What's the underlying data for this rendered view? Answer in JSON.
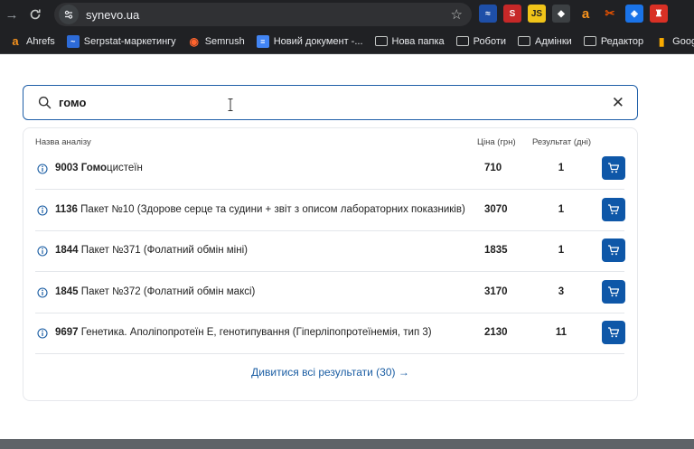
{
  "browser": {
    "url": "synevo.ua",
    "bookmarks": [
      {
        "label": "Ahrefs",
        "icon": "ahrefs-icon",
        "color": "#f7931e"
      },
      {
        "label": "Serpstat-маркетингу",
        "icon": "serpstat-icon",
        "color": "#2d6bd8"
      },
      {
        "label": "Semrush",
        "icon": "semrush-icon",
        "color": "#ff642d"
      },
      {
        "label": "Новий документ -...",
        "icon": "docs-icon",
        "color": "#4285f4"
      },
      {
        "label": "Нова папка",
        "icon": "folder-icon"
      },
      {
        "label": "Роботи",
        "icon": "folder-icon"
      },
      {
        "label": "Адмінки",
        "icon": "folder-icon"
      },
      {
        "label": "Редактор",
        "icon": "folder-icon"
      },
      {
        "label": "Google Аналит",
        "icon": "analytics-icon",
        "color": "#f9ab00"
      }
    ]
  },
  "search": {
    "query": "гомо"
  },
  "results": {
    "headers": {
      "name": "Назва аналізу",
      "price": "Ціна (грн)",
      "days": "Результат (дні)"
    },
    "rows": [
      {
        "code": "9003",
        "match": "Гомо",
        "rest": "цистеїн",
        "price": "710",
        "days": "1"
      },
      {
        "code": "1136",
        "match": "",
        "rest": "Пакет №10 (Здорове серце та судини + звіт з описом лабораторних показників)",
        "price": "3070",
        "days": "1"
      },
      {
        "code": "1844",
        "match": "",
        "rest": "Пакет №371 (Фолатний обмін міні)",
        "price": "1835",
        "days": "1"
      },
      {
        "code": "1845",
        "match": "",
        "rest": "Пакет №372 (Фолатний обмін максі)",
        "price": "3170",
        "days": "3"
      },
      {
        "code": "9697",
        "match": "",
        "rest": "Генетика. Аполіпопротеїн Е, генотипування (Гіперліпопротеїнемія, тип 3)",
        "price": "2130",
        "days": "11"
      }
    ],
    "more_label": "Дивитися всі результати (30) →"
  },
  "colors": {
    "accent": "#0e57a8",
    "link": "#1a5da3",
    "border": "#1f5fa8"
  }
}
